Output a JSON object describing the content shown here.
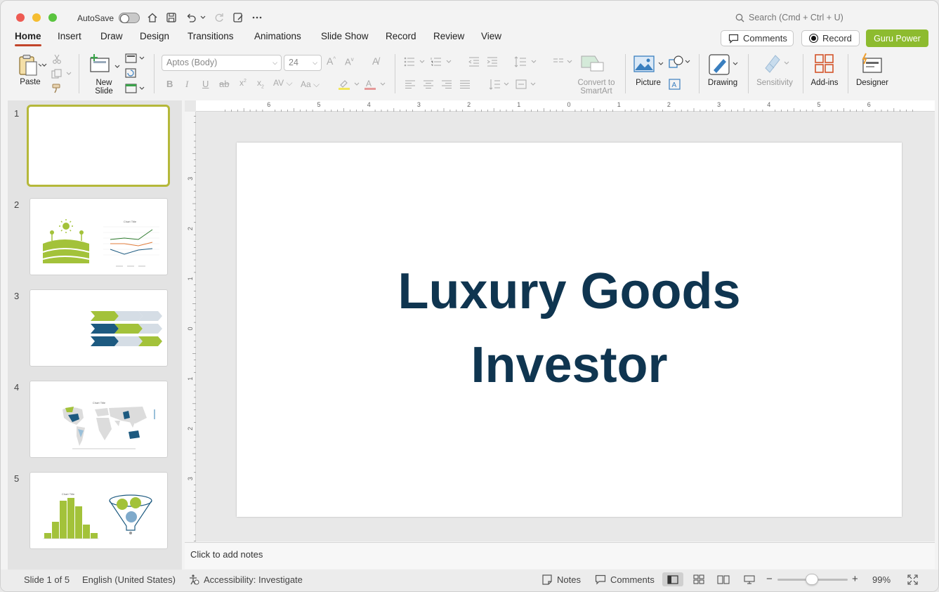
{
  "titlebar": {
    "autosave_label": "AutoSave",
    "search_placeholder": "Search (Cmd + Ctrl + U)"
  },
  "tabs": [
    {
      "label": "Home",
      "active": true
    },
    {
      "label": "Insert"
    },
    {
      "label": "Draw"
    },
    {
      "label": "Design"
    },
    {
      "label": "Transitions"
    },
    {
      "label": "Animations"
    },
    {
      "label": "Slide Show"
    },
    {
      "label": "Record"
    },
    {
      "label": "Review"
    },
    {
      "label": "View"
    }
  ],
  "topright": {
    "comments_label": "Comments",
    "record_label": "Record",
    "guru_label": "Guru Power",
    "guru_color": "#8dbb2f"
  },
  "ribbon": {
    "paste_label": "Paste",
    "new_slide_label": "New Slide",
    "font_name": "Aptos (Body)",
    "font_size": "24",
    "convert_label": "Convert to SmartArt",
    "picture_label": "Picture",
    "drawing_label": "Drawing",
    "sensitivity_label": "Sensitivity",
    "addins_label": "Add-ins",
    "designer_label": "Designer"
  },
  "thumbnails": {
    "numbers": [
      "1",
      "2",
      "3",
      "4",
      "5"
    ],
    "chart_title": "Chart Title"
  },
  "ruler": {
    "h_labels": [
      "6",
      "5",
      "4",
      "3",
      "2",
      "1",
      "0",
      "1",
      "2",
      "3",
      "4",
      "5",
      "6"
    ],
    "v_labels": [
      "3",
      "2",
      "1",
      "0",
      "1",
      "2",
      "3"
    ]
  },
  "slide": {
    "title_line1": "Luxury Goods",
    "title_line2": "Investor",
    "title_color": "#0f3550"
  },
  "notes": {
    "placeholder": "Click to add notes"
  },
  "status": {
    "slide_indicator": "Slide 1 of 5",
    "language": "English (United States)",
    "accessibility": "Accessibility: Investigate",
    "notes_label": "Notes",
    "comments_label": "Comments",
    "zoom": "99%"
  },
  "colors": {
    "accent_green": "#a3c23a",
    "accent_navy": "#1d5a80",
    "tab_underline": "#c2452b"
  }
}
